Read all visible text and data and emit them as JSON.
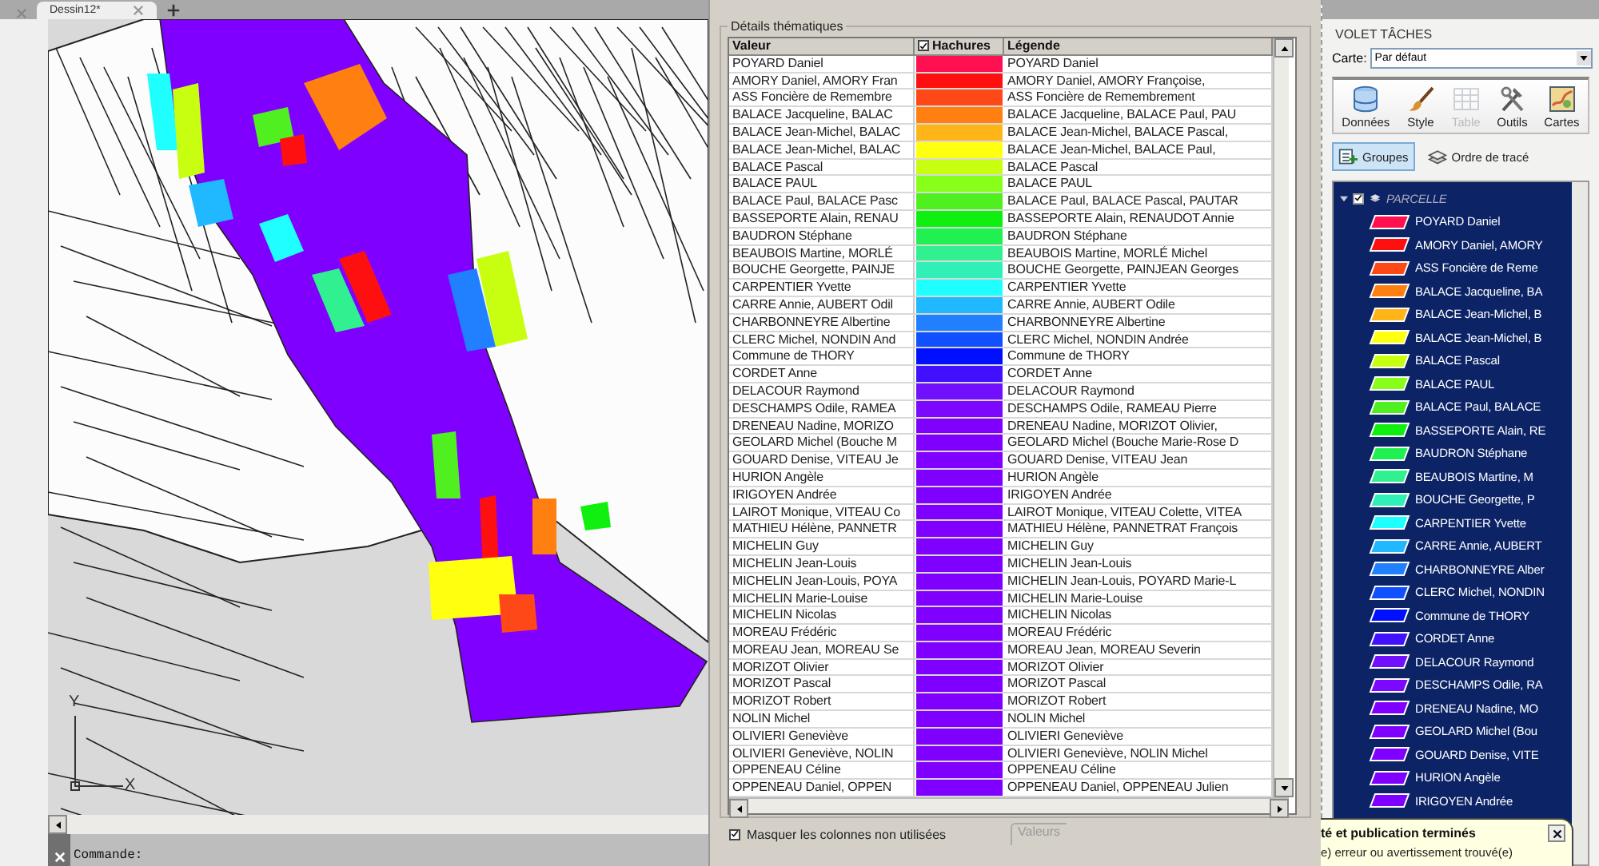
{
  "doc_tabs": {
    "tabs": [
      {
        "label": "Dessin12*",
        "selected": true
      }
    ]
  },
  "ucs": {
    "y_label": "Y",
    "x_label": "X"
  },
  "command_line": {
    "prompt": "Commande:"
  },
  "dialog": {
    "group_title": "Détails thématiques",
    "columns": [
      {
        "label": "Valeur"
      },
      {
        "label": "Hachures",
        "checked": true
      },
      {
        "label": "Légende"
      }
    ],
    "rows": [
      {
        "value": " POYARD Daniel",
        "color": "#ff1050",
        "legend": " POYARD Daniel"
      },
      {
        "value": "AMORY Daniel, AMORY Fran",
        "color": "#ff1010",
        "legend": "AMORY Daniel, AMORY Françoise,"
      },
      {
        "value": "ASS Foncière de Remembre",
        "color": "#ff4818",
        "legend": "ASS Foncière de Remembrement"
      },
      {
        "value": "BALACE Jacqueline, BALAC",
        "color": "#ff8010",
        "legend": "BALACE Jacqueline, BALACE Paul, PAU"
      },
      {
        "value": "BALACE Jean-Michel, BALAC",
        "color": "#ffb418",
        "legend": "BALACE Jean-Michel, BALACE Pascal,"
      },
      {
        "value": "BALACE Jean-Michel, BALAC",
        "color": "#ffff10",
        "legend": "BALACE Jean-Michel, BALACE Paul,"
      },
      {
        "value": "BALACE Pascal",
        "color": "#c8ff10",
        "legend": "BALACE Pascal"
      },
      {
        "value": "BALACE PAUL",
        "color": "#88ff18",
        "legend": "BALACE PAUL"
      },
      {
        "value": "BALACE Paul, BALACE Pasc",
        "color": "#50f020",
        "legend": "BALACE Paul, BALACE Pascal, PAUTAR"
      },
      {
        "value": "BASSEPORTE Alain, RENAU",
        "color": "#10f010",
        "legend": "BASSEPORTE Alain, RENAUDOT Annie"
      },
      {
        "value": "BAUDRON Stéphane",
        "color": "#20f050",
        "legend": "BAUDRON Stéphane"
      },
      {
        "value": "BEAUBOIS Martine, MORLÉ",
        "color": "#30f090",
        "legend": "BEAUBOIS Martine, MORLÉ Michel"
      },
      {
        "value": "BOUCHE Georgette, PAINJE",
        "color": "#30f0b8",
        "legend": "BOUCHE Georgette, PAINJEAN Georges"
      },
      {
        "value": "CARPENTIER Yvette",
        "color": "#20ffff",
        "legend": "CARPENTIER Yvette"
      },
      {
        "value": "CARRE Annie, AUBERT Odil",
        "color": "#20b8ff",
        "legend": "CARRE Annie, AUBERT Odile"
      },
      {
        "value": "CHARBONNEYRE Albertine",
        "color": "#2080ff",
        "legend": "CHARBONNEYRE Albertine"
      },
      {
        "value": "CLERC Michel, NONDIN And",
        "color": "#1050ff",
        "legend": "CLERC Michel, NONDIN Andrée"
      },
      {
        "value": "Commune de THORY",
        "color": "#0010ff",
        "legend": "Commune de THORY"
      },
      {
        "value": "CORDET Anne",
        "color": "#4010ff",
        "legend": "CORDET Anne"
      },
      {
        "value": "DELACOUR Raymond",
        "color": "#7010ff",
        "legend": "DELACOUR Raymond"
      },
      {
        "value": "DESCHAMPS Odile, RAMEA",
        "color": "#7c08ff",
        "legend": "DESCHAMPS Odile, RAMEAU Pierre"
      },
      {
        "value": "DRENEAU Nadine, MORIZO",
        "color": "#8000ff",
        "legend": "DRENEAU Nadine, MORIZOT Olivier,"
      },
      {
        "value": "GEOLARD Michel (Bouche M",
        "color": "#8000ff",
        "legend": "GEOLARD Michel (Bouche Marie-Rose D"
      },
      {
        "value": "GOUARD Denise, VITEAU Je",
        "color": "#8000ff",
        "legend": "GOUARD Denise, VITEAU Jean"
      },
      {
        "value": "HURION Angèle",
        "color": "#8000ff",
        "legend": "HURION Angèle"
      },
      {
        "value": "IRIGOYEN Andrée",
        "color": "#8000ff",
        "legend": "IRIGOYEN Andrée"
      },
      {
        "value": "LAIROT Monique, VITEAU Co",
        "color": "#8000ff",
        "legend": "LAIROT Monique, VITEAU Colette, VITEA"
      },
      {
        "value": "MATHIEU Hélène, PANNETR",
        "color": "#8000ff",
        "legend": "MATHIEU Hélène, PANNETRAT François"
      },
      {
        "value": "MICHELIN Guy",
        "color": "#8000ff",
        "legend": "MICHELIN Guy"
      },
      {
        "value": "MICHELIN Jean-Louis",
        "color": "#8000ff",
        "legend": "MICHELIN Jean-Louis"
      },
      {
        "value": "MICHELIN Jean-Louis, POYA",
        "color": "#8000ff",
        "legend": "MICHELIN Jean-Louis, POYARD Marie-L"
      },
      {
        "value": "MICHELIN Marie-Louise",
        "color": "#8000ff",
        "legend": "MICHELIN Marie-Louise"
      },
      {
        "value": "MICHELIN Nicolas",
        "color": "#8000ff",
        "legend": "MICHELIN Nicolas"
      },
      {
        "value": "MOREAU Frédéric",
        "color": "#8000ff",
        "legend": "MOREAU Frédéric"
      },
      {
        "value": "MOREAU Jean, MOREAU Se",
        "color": "#8000ff",
        "legend": "MOREAU Jean, MOREAU Severin"
      },
      {
        "value": "MORIZOT Olivier",
        "color": "#8000ff",
        "legend": "MORIZOT Olivier"
      },
      {
        "value": "MORIZOT Pascal",
        "color": "#8000ff",
        "legend": "MORIZOT Pascal"
      },
      {
        "value": "MORIZOT Robert",
        "color": "#8000ff",
        "legend": "MORIZOT Robert"
      },
      {
        "value": "NOLIN Michel",
        "color": "#8000ff",
        "legend": "NOLIN Michel"
      },
      {
        "value": "OLIVIERI Geneviève",
        "color": "#8000ff",
        "legend": "OLIVIERI Geneviève"
      },
      {
        "value": "OLIVIERI Geneviève, NOLIN",
        "color": "#8000ff",
        "legend": "OLIVIERI Geneviève, NOLIN Michel"
      },
      {
        "value": "OPPENEAU Céline",
        "color": "#8000ff",
        "legend": "OPPENEAU Céline"
      },
      {
        "value": "OPPENEAU Daniel, OPPEN",
        "color": "#8000ff",
        "legend": "OPPENEAU Daniel, OPPENEAU Julien"
      }
    ],
    "hide_unused": {
      "label": "Masquer les colonnes non utilisées",
      "checked": true
    },
    "values_group": "Valeurs"
  },
  "task_pane": {
    "title": "VOLET TÂCHES",
    "map_label": "Carte:",
    "map_value": "Par défaut",
    "tools": [
      {
        "kind": "data",
        "label": "Données",
        "disabled": false
      },
      {
        "kind": "style",
        "label": "Style",
        "disabled": false
      },
      {
        "kind": "table",
        "label": "Table",
        "disabled": true
      },
      {
        "kind": "tools",
        "label": "Outils",
        "disabled": false
      },
      {
        "kind": "maps",
        "label": "Cartes",
        "disabled": false
      }
    ],
    "views": [
      {
        "kind": "groups",
        "label": "Groupes",
        "selected": true
      },
      {
        "kind": "order",
        "label": "Ordre de tracé",
        "selected": false
      }
    ],
    "tree": {
      "label": "PARCELLE",
      "checked": true,
      "expanded": true,
      "children": [
        {
          "label": " POYARD Daniel",
          "color": "#ff1050"
        },
        {
          "label": "AMORY Daniel, AMORY",
          "color": "#ff1010"
        },
        {
          "label": "ASS Foncière de Reme",
          "color": "#ff4818"
        },
        {
          "label": "BALACE Jacqueline, BA",
          "color": "#ff8010"
        },
        {
          "label": "BALACE Jean-Michel, B",
          "color": "#ffb418"
        },
        {
          "label": "BALACE Jean-Michel, B",
          "color": "#ffff10"
        },
        {
          "label": "BALACE Pascal",
          "color": "#c8ff10"
        },
        {
          "label": "BALACE PAUL",
          "color": "#88ff18"
        },
        {
          "label": "BALACE Paul, BALACE",
          "color": "#50f020"
        },
        {
          "label": "BASSEPORTE Alain, RE",
          "color": "#10f010"
        },
        {
          "label": "BAUDRON Stéphane",
          "color": "#20f050"
        },
        {
          "label": "BEAUBOIS Martine, M",
          "color": "#30f090"
        },
        {
          "label": "BOUCHE Georgette, P",
          "color": "#30f0b8"
        },
        {
          "label": "CARPENTIER Yvette",
          "color": "#20ffff"
        },
        {
          "label": "CARRE Annie, AUBERT",
          "color": "#20b8ff"
        },
        {
          "label": "CHARBONNEYRE Alber",
          "color": "#2080ff"
        },
        {
          "label": "CLERC Michel, NONDIN",
          "color": "#1050ff"
        },
        {
          "label": "Commune de THORY",
          "color": "#0010ff"
        },
        {
          "label": "CORDET Anne",
          "color": "#4010ff"
        },
        {
          "label": "DELACOUR Raymond",
          "color": "#7010ff"
        },
        {
          "label": "DESCHAMPS Odile, RA",
          "color": "#7c08ff"
        },
        {
          "label": "DRENEAU Nadine, MO",
          "color": "#8000ff"
        },
        {
          "label": "GEOLARD Michel (Bou",
          "color": "#8000ff"
        },
        {
          "label": "GOUARD Denise, VITE",
          "color": "#8000ff"
        },
        {
          "label": "HURION Angèle",
          "color": "#8000ff"
        },
        {
          "label": "IRIGOYEN Andrée",
          "color": "#8000ff"
        }
      ]
    }
  },
  "notification": {
    "title": "té et publication terminés",
    "message": "e) erreur ou avertissement trouvé(e)"
  }
}
